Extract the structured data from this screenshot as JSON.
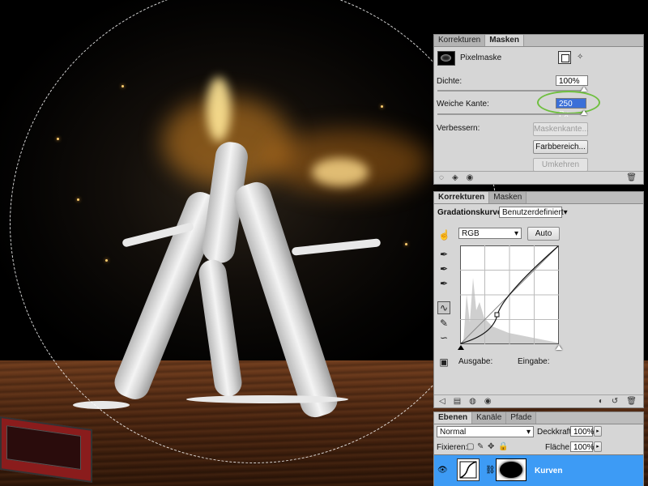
{
  "masks_panel": {
    "tabs": [
      "Korrekturen",
      "Masken"
    ],
    "active_tab": "Masken",
    "mask_type": "Pixelmaske",
    "density_label": "Dichte:",
    "density_value": "100%",
    "density_fraction": 1.0,
    "feather_label": "Weiche Kante:",
    "feather_value": "250 Px",
    "feather_fraction": 1.0,
    "refine_label": "Verbessern:",
    "buttons": {
      "mask_edge": "Maskenkante...",
      "color_range": "Farbbereich...",
      "invert": "Umkehren"
    },
    "highlight_color": "#6fbf3f"
  },
  "curves_panel": {
    "tabs": [
      "Korrekturen",
      "Masken"
    ],
    "active_tab": "Korrekturen",
    "title": "Gradationskurven",
    "preset": "Benutzerdefiniert",
    "channel": "RGB",
    "auto_label": "Auto",
    "output_label": "Ausgabe:",
    "input_label": "Eingabe:"
  },
  "layers_panel": {
    "tabs": [
      "Ebenen",
      "Kanäle",
      "Pfade"
    ],
    "active_tab": "Ebenen",
    "blend_mode": "Normal",
    "opacity_label": "Deckkraft:",
    "opacity_value": "100%",
    "lock_label": "Fixieren:",
    "fill_label": "Fläche:",
    "fill_value": "100%",
    "layer_name": "Kurven",
    "selected_color": "#3d9bf5"
  }
}
